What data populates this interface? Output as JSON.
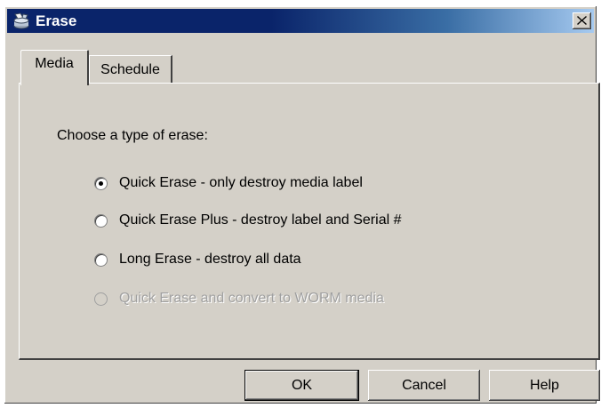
{
  "window": {
    "title": "Erase",
    "title_icon": "erase-app-icon",
    "close_icon": "close-icon"
  },
  "tabs": [
    {
      "label": "Media",
      "selected": true
    },
    {
      "label": "Schedule",
      "selected": false
    }
  ],
  "media_panel": {
    "prompt": "Choose a type of erase:",
    "options": [
      {
        "label": "Quick Erase - only destroy media label",
        "selected": true,
        "enabled": true
      },
      {
        "label": "Quick Erase Plus - destroy label and Serial #",
        "selected": false,
        "enabled": true
      },
      {
        "label": "Long Erase - destroy all data",
        "selected": false,
        "enabled": true
      },
      {
        "label": "Quick Erase and convert to WORM media",
        "selected": false,
        "enabled": false
      }
    ]
  },
  "buttons": {
    "ok": "OK",
    "cancel": "Cancel",
    "help": "Help"
  },
  "colors": {
    "titlebar_start": "#0a246a",
    "titlebar_end": "#a6caf0",
    "face": "#d4d0c8",
    "disabled_text": "#a0a0a0"
  }
}
